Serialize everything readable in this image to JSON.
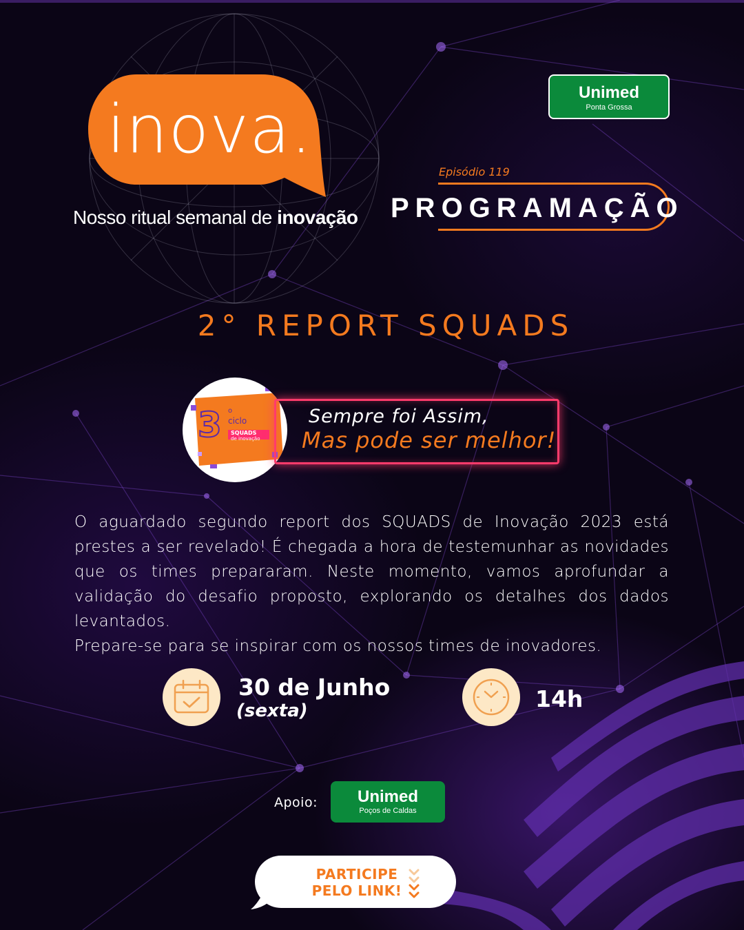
{
  "colors": {
    "background": "#0b0516",
    "accent_orange": "#f47a1f",
    "unimed_green": "#0b8a3b",
    "neon_pink": "#ff3b6b",
    "icon_bg": "#fde8c6"
  },
  "logo": {
    "wordmark": "inova.",
    "tagline_regular": "Nosso ritual semanal de ",
    "tagline_bold": "inovação"
  },
  "sponsor_top": {
    "name": "Unimed",
    "city": "Ponta Grossa"
  },
  "episode_label": "Episódio 119",
  "section_title": "PROGRAMAÇÃO",
  "report_title": "2° REPORT SQUADS",
  "squads_badge": {
    "number": "3",
    "superscript": "o",
    "ciclo": "ciclo",
    "squads": "SQUADS",
    "sub": "de inovação"
  },
  "slogan": {
    "line1": "Sempre foi Assim,",
    "line2": "Mas pode ser melhor!"
  },
  "description": {
    "paragraph": "O aguardado segundo report dos SQUADS de Inovação 2023 está prestes a ser revelado! É chegada a hora de testemunhar as novidades que os times prepararam. Neste momento, vamos aprofundar a validação do desafio proposto, explorando os detalhes dos dados levantados.",
    "closing": "Prepare-se para se inspirar com os nossos times de inovadores."
  },
  "event": {
    "date": "30 de Junho",
    "weekday": "(sexta)",
    "time": "14h",
    "calendar_icon": "calendar-check-icon",
    "clock_icon": "clock-icon"
  },
  "support": {
    "label": "Apoio:",
    "name": "Unimed",
    "city": "Poços de Caldas"
  },
  "cta": {
    "line1": "PARTICIPE",
    "line2": "PELO LINK!",
    "icon": "chevron-double-down-icon"
  }
}
